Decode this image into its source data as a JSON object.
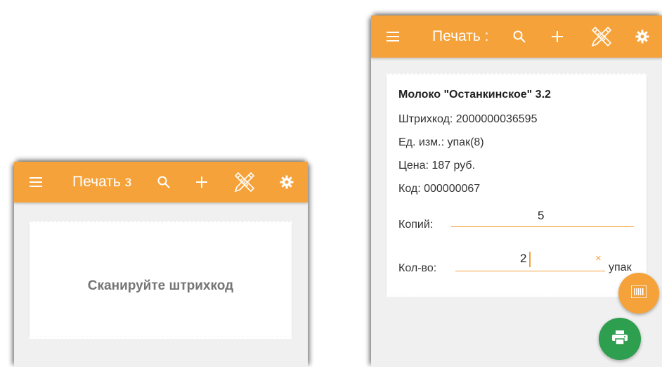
{
  "colors": {
    "accent": "#f5a23a",
    "fab_print": "#2e9e4f",
    "background": "#f0f0f0"
  },
  "left_screen": {
    "appbar": {
      "menu_icon": "menu-icon",
      "title": "Печать з",
      "search_icon": "search-icon",
      "add_icon": "plus-icon",
      "tools_icon": "pencil-ruler-icon",
      "settings_icon": "gear-icon"
    },
    "card": {
      "message": "Сканируйте штрихкод"
    }
  },
  "right_screen": {
    "appbar": {
      "menu_icon": "menu-icon",
      "title": "Печать :",
      "search_icon": "search-icon",
      "add_icon": "plus-icon",
      "tools_icon": "pencil-ruler-icon",
      "settings_icon": "gear-icon"
    },
    "product": {
      "name": "Молоко \"Останкинское\" 3.2",
      "barcode": "Штрихкод: 2000000036595",
      "unit": "Ед. изм.: упак(8)",
      "price": "Цена: 187 руб.",
      "code": "Код: 000000067"
    },
    "copies": {
      "label": "Копий:",
      "value": "5"
    },
    "quantity": {
      "label": "Кол-во:",
      "value": "2",
      "clear": "×",
      "unit": "упак"
    },
    "fab_scan_icon": "barcode-icon",
    "fab_print_icon": "printer-icon"
  }
}
